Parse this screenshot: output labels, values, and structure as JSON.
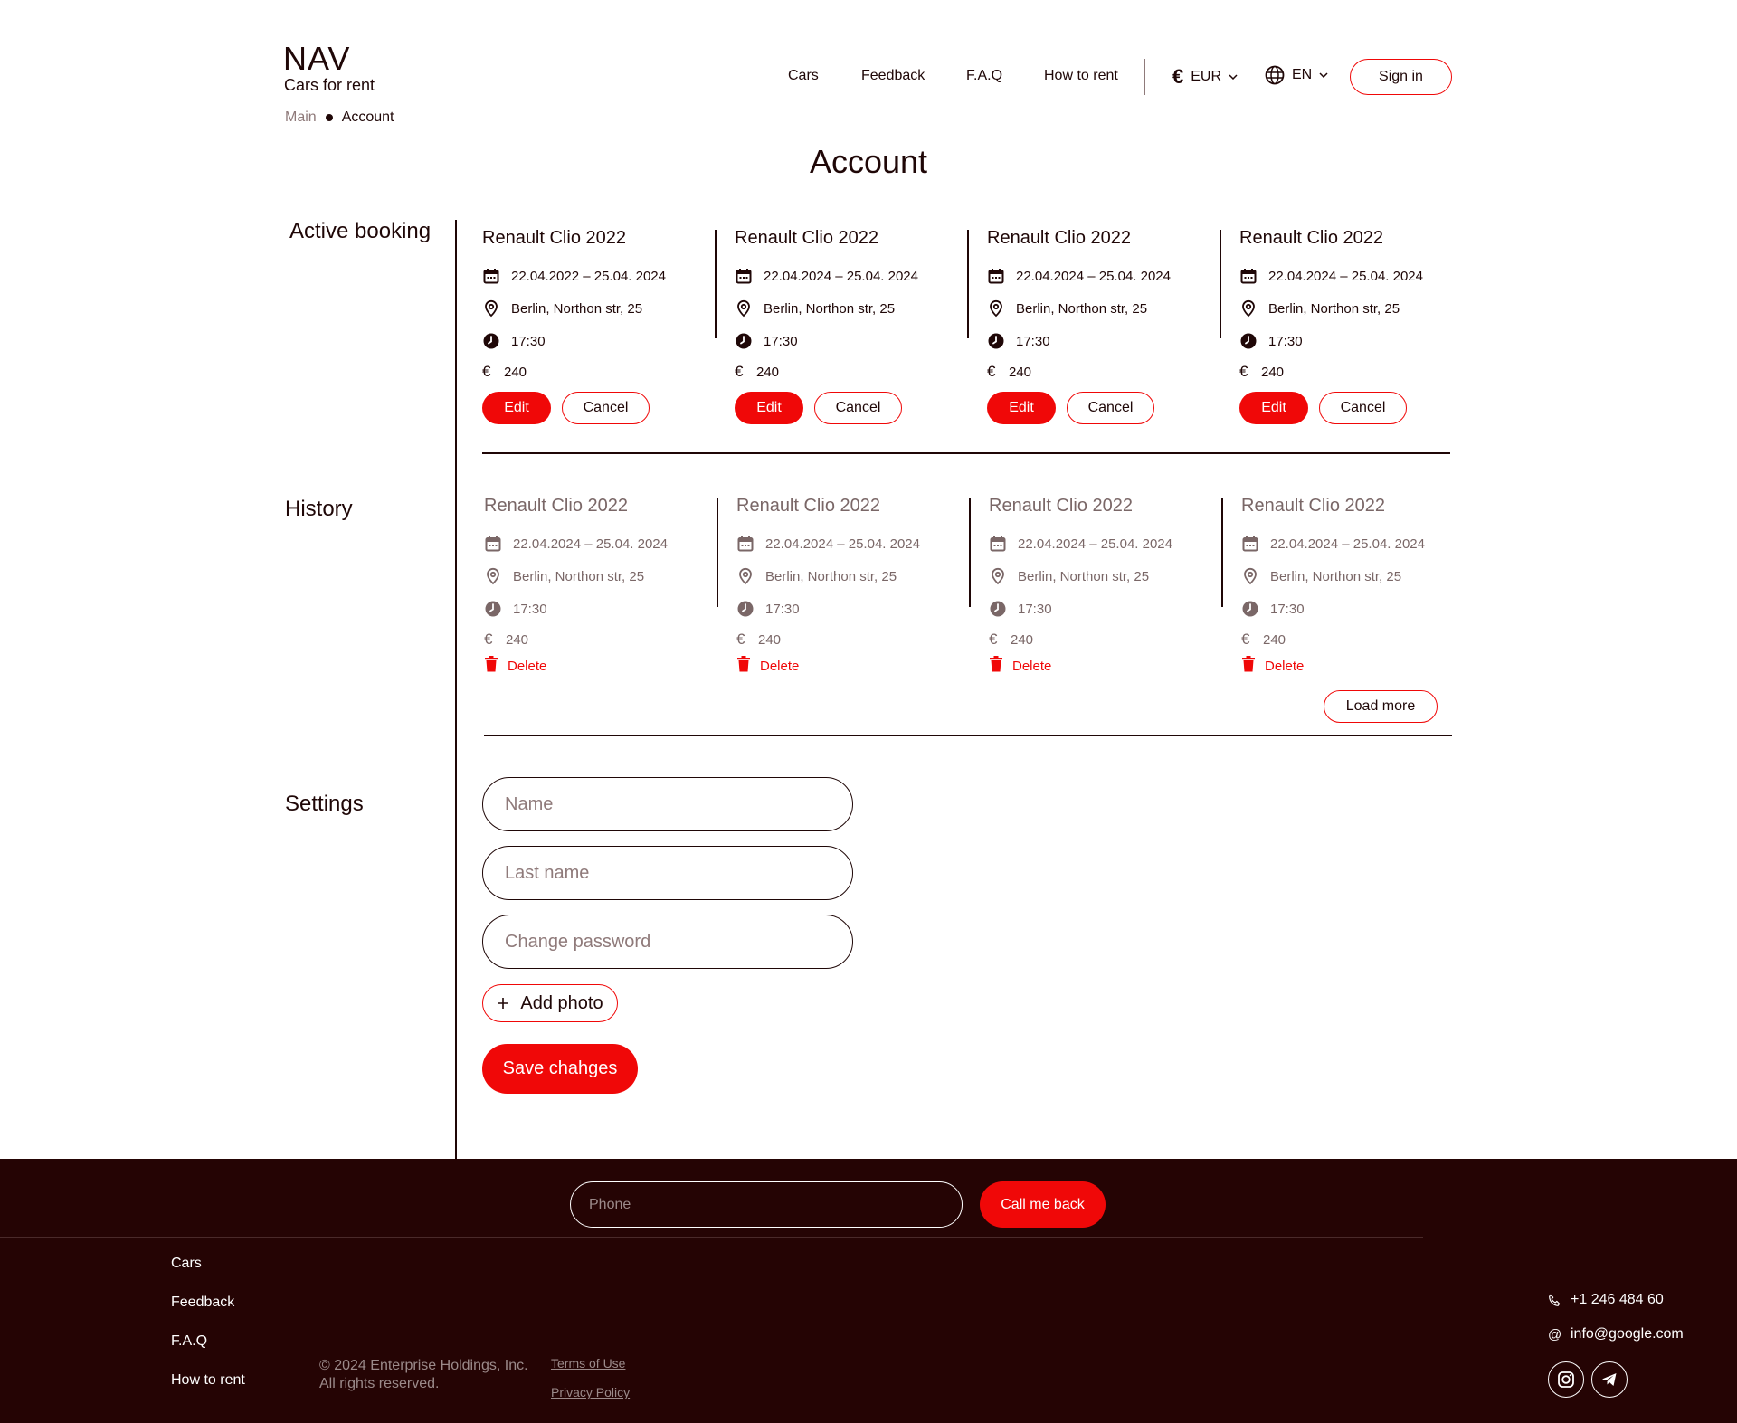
{
  "header": {
    "logo": "NAV",
    "logo_sub": "Cars for rent",
    "breadcrumb": {
      "main": "Main",
      "current": "Account"
    },
    "nav": [
      "Cars",
      "Feedback",
      "F.A.Q",
      "How to rent"
    ],
    "currency": "EUR",
    "language": "EN",
    "signin": "Sign in"
  },
  "page_title": "Account",
  "sections": {
    "active": "Active booking",
    "history": "History",
    "settings": "Settings"
  },
  "active_bookings": [
    {
      "title": "Renault Clio 2022",
      "dates": "22.04.2022 – 25.04. 2024",
      "location": "Berlin, Northon str, 25",
      "time": "17:30",
      "price": "240"
    },
    {
      "title": "Renault Clio 2022",
      "dates": "22.04.2024 – 25.04. 2024",
      "location": "Berlin, Northon str, 25",
      "time": "17:30",
      "price": "240"
    },
    {
      "title": "Renault Clio 2022",
      "dates": "22.04.2024 – 25.04. 2024",
      "location": "Berlin, Northon str, 25",
      "time": "17:30",
      "price": "240"
    },
    {
      "title": "Renault Clio 2022",
      "dates": "22.04.2024 – 25.04. 2024",
      "location": "Berlin, Northon str, 25",
      "time": "17:30",
      "price": "240"
    }
  ],
  "history_bookings": [
    {
      "title": "Renault Clio 2022",
      "dates": "22.04.2024 – 25.04. 2024",
      "location": "Berlin, Northon str, 25",
      "time": "17:30",
      "price": "240"
    },
    {
      "title": "Renault Clio 2022",
      "dates": "22.04.2024 – 25.04. 2024",
      "location": "Berlin, Northon str, 25",
      "time": "17:30",
      "price": "240"
    },
    {
      "title": "Renault Clio 2022",
      "dates": "22.04.2024 – 25.04. 2024",
      "location": "Berlin, Northon str, 25",
      "time": "17:30",
      "price": "240"
    },
    {
      "title": "Renault Clio 2022",
      "dates": "22.04.2024 – 25.04. 2024",
      "location": "Berlin, Northon str, 25",
      "time": "17:30",
      "price": "240"
    }
  ],
  "labels": {
    "currency_symbol": "€",
    "edit": "Edit",
    "cancel": "Cancel",
    "delete": "Delete",
    "load_more": "Load more"
  },
  "settings": {
    "name_placeholder": "Name",
    "lastname_placeholder": "Last name",
    "password_placeholder": "Change password",
    "add_photo": "Add photo",
    "save": "Save chahges"
  },
  "footer": {
    "phone_placeholder": "Phone",
    "callback": "Call me back",
    "nav": [
      "Cars",
      "Feedback",
      "F.A.Q",
      "How to rent"
    ],
    "copyright_1": "© 2024 Enterprise Holdings, Inc.",
    "copyright_2": "All rights reserved.",
    "terms": "Terms of Use",
    "privacy": "Privacy Policy",
    "phone": "+1 246 484 60",
    "email": "info@google.com"
  },
  "colors": {
    "accent": "#f00808",
    "text": "#1f0707",
    "footer_bg": "#250404",
    "muted": "#7a6767"
  }
}
